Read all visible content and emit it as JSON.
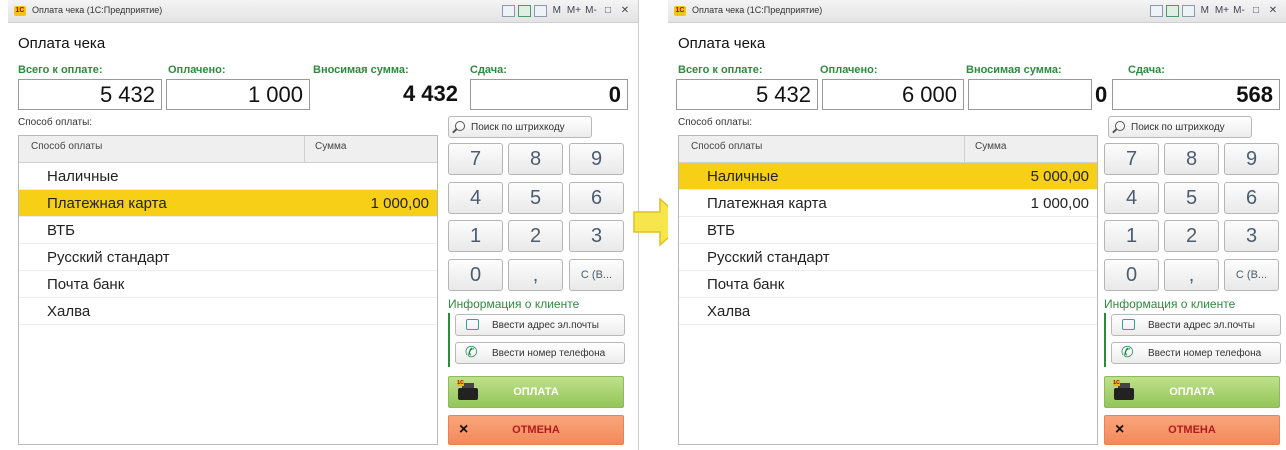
{
  "colors": {
    "highlight_row": "#f6cf16",
    "label_green": "#2e8b3d",
    "pay_button": "#a9d36f",
    "cancel_button": "#f59b6b",
    "arrow": "#f7e64b"
  },
  "icons": {
    "arrow": "right-arrow-icon",
    "search": "magnifier-icon",
    "mail": "envelope-icon",
    "phone": "phone-icon",
    "kkm": "cash-register-icon",
    "cancel": "close-icon"
  },
  "windows": [
    {
      "window_title": "Оплата чека  (1С:Предприятие)",
      "toolbar": [
        "M",
        "M+",
        "M-",
        "□",
        "✕"
      ],
      "form_title": "Оплата чека",
      "labels": {
        "total": "Всего к оплате:",
        "paid": "Оплачено:",
        "entered": "Вносимая сумма:",
        "change": "Сдача:"
      },
      "values": {
        "total": "5 432",
        "paid": "1 000",
        "entered": "4 432",
        "entered_overflow": "",
        "change": "0"
      },
      "payment_method_label": "Способ оплаты:",
      "table": {
        "headers": [
          "Способ оплаты",
          "Сумма"
        ],
        "rows": [
          {
            "name": "Наличные",
            "sum": "",
            "selected": false
          },
          {
            "name": "Платежная карта",
            "sum": "1 000,00",
            "selected": true
          },
          {
            "name": "ВТБ",
            "sum": "",
            "selected": false
          },
          {
            "name": "Русский стандарт",
            "sum": "",
            "selected": false
          },
          {
            "name": "Почта банк",
            "sum": "",
            "selected": false
          },
          {
            "name": "Халва",
            "sum": "",
            "selected": false
          }
        ]
      },
      "barcode_button": "Поиск по штрихкоду",
      "keypad": [
        "7",
        "8",
        "9",
        "4",
        "5",
        "6",
        "1",
        "2",
        "3",
        "0",
        ",",
        "С (В..."
      ],
      "client_info_title": "Информация о клиенте",
      "email_button": "Ввести адрес эл.почты",
      "phone_button": "Ввести номер телефона",
      "pay_button": "ОПЛАТА",
      "cancel_button": "ОТМЕНА"
    },
    {
      "window_title": "Оплата чека  (1С:Предприятие)",
      "toolbar": [
        "M",
        "M+",
        "M-",
        "□",
        "✕"
      ],
      "form_title": "Оплата чека",
      "labels": {
        "total": "Всего к оплате:",
        "paid": "Оплачено:",
        "entered": "Вносимая сумма:",
        "change": "Сдача:"
      },
      "values": {
        "total": "5 432",
        "paid": "6 000",
        "entered": "",
        "entered_overflow": "0",
        "change": "568"
      },
      "payment_method_label": "Способ оплаты:",
      "table": {
        "headers": [
          "Способ оплаты",
          "Сумма"
        ],
        "rows": [
          {
            "name": "Наличные",
            "sum": "5 000,00",
            "selected": true
          },
          {
            "name": "Платежная карта",
            "sum": "1 000,00",
            "selected": false
          },
          {
            "name": "ВТБ",
            "sum": "",
            "selected": false
          },
          {
            "name": "Русский стандарт",
            "sum": "",
            "selected": false
          },
          {
            "name": "Почта банк",
            "sum": "",
            "selected": false
          },
          {
            "name": "Халва",
            "sum": "",
            "selected": false
          }
        ]
      },
      "barcode_button": "Поиск по штрихкоду",
      "keypad": [
        "7",
        "8",
        "9",
        "4",
        "5",
        "6",
        "1",
        "2",
        "3",
        "0",
        ",",
        "С (В..."
      ],
      "client_info_title": "Информация о клиенте",
      "email_button": "Ввести адрес эл.почты",
      "phone_button": "Ввести номер телефона",
      "pay_button": "ОПЛАТА",
      "cancel_button": "ОТМЕНА"
    }
  ]
}
